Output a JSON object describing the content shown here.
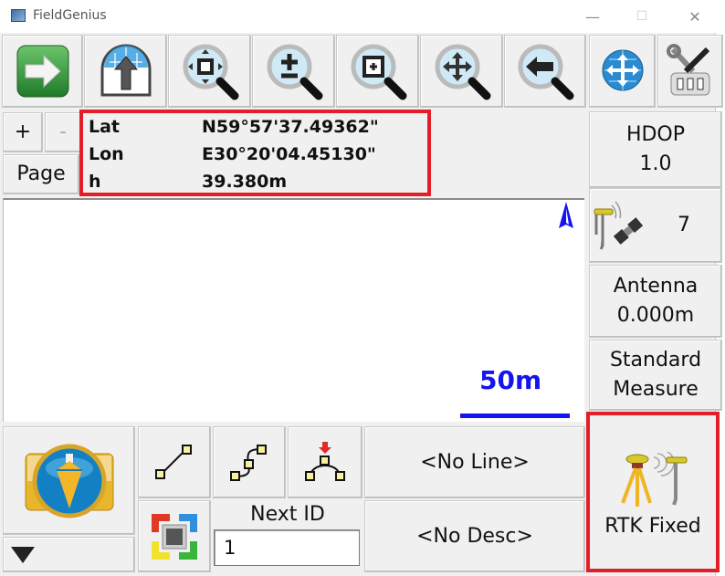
{
  "window": {
    "title": "FieldGenius",
    "controls": {
      "minimize": "—",
      "maximize": "☐",
      "close": "✕"
    }
  },
  "toolbar": {
    "buttons": [
      {
        "name": "next-arrow",
        "icon": "green-right-arrow-icon"
      },
      {
        "name": "upload-globe",
        "icon": "globe-up-arrow-icon"
      },
      {
        "name": "zoom-extents",
        "icon": "zoom-extents-magnifier-icon"
      },
      {
        "name": "zoom-in-out",
        "icon": "zoom-plus-minus-magnifier-icon"
      },
      {
        "name": "zoom-window",
        "icon": "zoom-window-magnifier-icon"
      },
      {
        "name": "pan",
        "icon": "pan-magnifier-icon"
      },
      {
        "name": "zoom-previous",
        "icon": "zoom-previous-magnifier-icon"
      },
      {
        "name": "globe-pan",
        "icon": "globe-move-icon"
      },
      {
        "name": "instrument-settings",
        "icon": "tools-settings-icon"
      }
    ]
  },
  "zoom_controls": {
    "plus": "+",
    "minus": "-",
    "page": "Page"
  },
  "coordinates": {
    "rows": [
      {
        "label": "Lat",
        "value": "N59°57'37.49362\""
      },
      {
        "label": "Lon",
        "value": "E30°20'04.45130\""
      },
      {
        "label": "h",
        "value": "39.380m"
      }
    ]
  },
  "status_panel": {
    "hdop_label": "HDOP",
    "hdop_value": "1.0",
    "satellites": "7",
    "antenna_label": "Antenna",
    "antenna_value": "0.000m",
    "mode_line1": "Standard",
    "mode_line2": "Measure",
    "rtk_status": "RTK Fixed"
  },
  "map": {
    "scale_label": "50m",
    "north_arrow": "north-arrow-icon",
    "accent_color": "#1414ee"
  },
  "bottom": {
    "line_button": "<No Line>",
    "desc_button": "<No Desc>",
    "next_id_label": "Next ID",
    "next_id_value": "1"
  },
  "colors": {
    "highlight": "#e41e26",
    "map_blue": "#1414ee"
  }
}
